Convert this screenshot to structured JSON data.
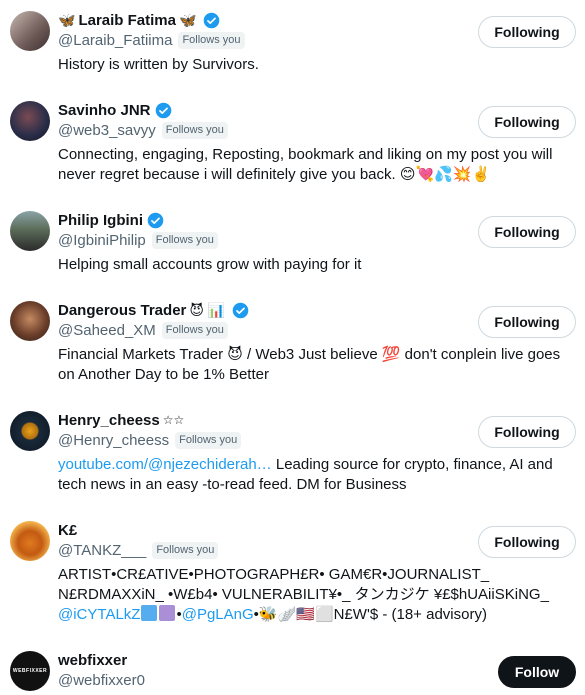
{
  "users": [
    {
      "name": "Laraib Fatima",
      "name_prefix": "🦋",
      "name_suffix": "🦋",
      "handle": "@Laraib_Fatiima",
      "follows_you": "Follows you",
      "bio": "History is written by Survivors.",
      "button": "Following"
    },
    {
      "name": "Savinho JNR",
      "handle": "@web3_savyy",
      "follows_you": "Follows you",
      "bio": "Connecting, engaging, Reposting, bookmark and liking on my post you will never regret because i will definitely give you back. 😊💘💦💥✌️",
      "button": "Following"
    },
    {
      "name": "Philip Igbini",
      "handle": "@IgbiniPhilip",
      "follows_you": "Follows you",
      "bio": "Helping small accounts grow with paying for it",
      "button": "Following"
    },
    {
      "name": "Dangerous Trader",
      "name_suffix": "😈 📊",
      "handle": "@Saheed_XM",
      "follows_you": "Follows you",
      "bio": "Financial Markets Trader 😈 / Web3 Just believe 💯 don't conplein live goes on Another Day to be 1% Better",
      "button": "Following"
    },
    {
      "name": "Henry_cheess",
      "name_suffix": "☆☆",
      "handle": "@Henry_cheess",
      "follows_you": "Follows you",
      "bio_link": "youtube.com/@njezechiderah…",
      "bio": " Leading source for crypto, finance, AI and tech news in an easy -to-read feed. DM for Business",
      "button": "Following"
    },
    {
      "name": "K£",
      "handle": "@TANKZ___",
      "follows_you": "Follows you",
      "bio_line1": "ARTIST•CR£ATIVE•PHOTOGRAPH£R• GAM€R•JOURNALIST_ N£RDMAXXiN_ •W£b4• VULNERABILIT¥•_ タンカジケ ¥£$hUAiiSKiNG_",
      "bio_link1": "@iCYTALkZ",
      "bio_mid": "•",
      "bio_link2": "@PgLAnG",
      "bio_tail": "•🐝🪽🇺🇸⬜N£W'$ - (18+ advisory)",
      "button": "Following"
    },
    {
      "name": "webfixxer",
      "handle": "@webfixxer0",
      "avatar_text": "WEBFIXXER",
      "button": "Follow"
    }
  ],
  "colors": {
    "accent": "#1d9bf0",
    "text": "#0f1419",
    "muted": "#536471",
    "badge_bg": "#eff3f4"
  }
}
